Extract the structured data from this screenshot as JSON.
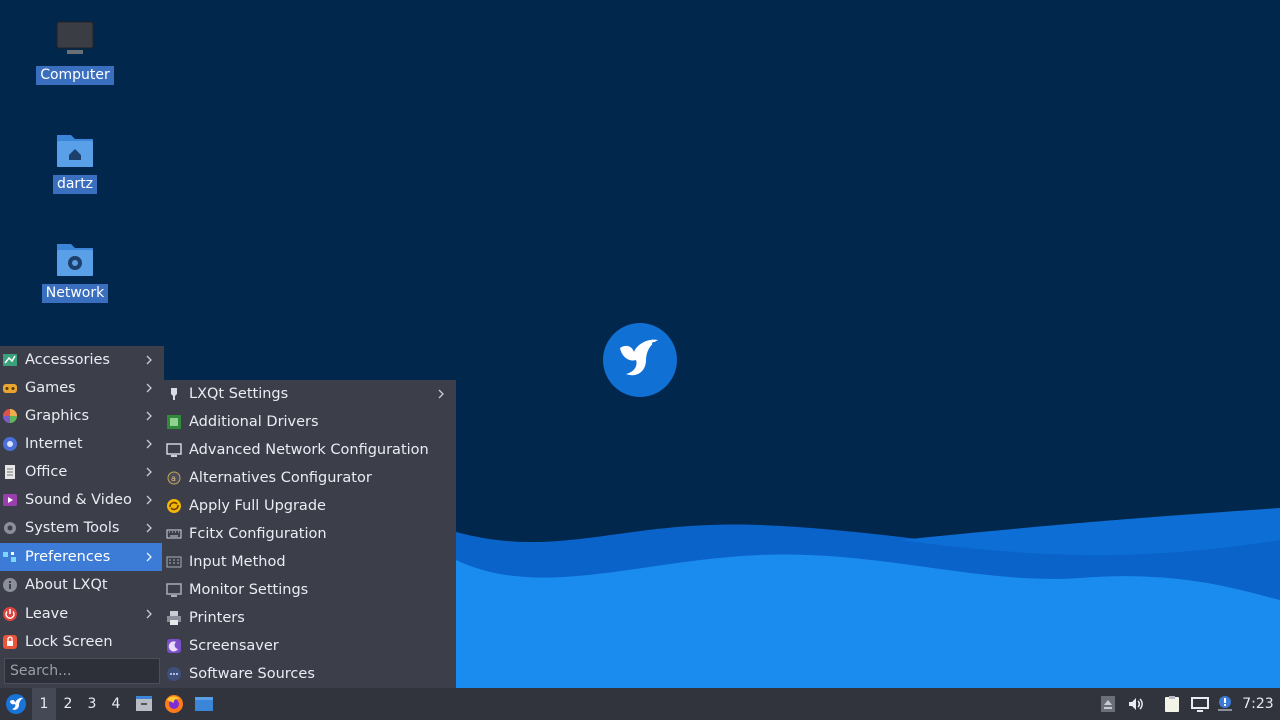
{
  "desktop": {
    "icons": [
      {
        "label": "Computer",
        "icon": "computer-icon"
      },
      {
        "label": "dartz",
        "icon": "home-folder-icon"
      },
      {
        "label": "Network",
        "icon": "network-folder-icon"
      }
    ],
    "logo": "lubuntu-bird-logo"
  },
  "main_menu": {
    "items": [
      {
        "label": "Accessories",
        "icon": "accessories-icon",
        "has_submenu": true
      },
      {
        "label": "Games",
        "icon": "games-icon",
        "has_submenu": true
      },
      {
        "label": "Graphics",
        "icon": "graphics-icon",
        "has_submenu": true
      },
      {
        "label": "Internet",
        "icon": "internet-icon",
        "has_submenu": true
      },
      {
        "label": "Office",
        "icon": "office-icon",
        "has_submenu": true
      },
      {
        "label": "Sound & Video",
        "icon": "sound-video-icon",
        "has_submenu": true
      },
      {
        "label": "System Tools",
        "icon": "system-tools-icon",
        "has_submenu": true
      },
      {
        "label": "Preferences",
        "icon": "preferences-icon",
        "has_submenu": true,
        "active": true
      },
      {
        "label": "About LXQt",
        "icon": "info-icon",
        "has_submenu": false
      },
      {
        "label": "Leave",
        "icon": "power-icon",
        "has_submenu": true
      },
      {
        "label": "Lock Screen",
        "icon": "lock-icon",
        "has_submenu": false
      }
    ],
    "search_placeholder": "Search..."
  },
  "sub_menu": {
    "items": [
      {
        "label": "LXQt Settings",
        "icon": "lxqt-settings-icon",
        "has_submenu": true
      },
      {
        "label": "Additional Drivers",
        "icon": "chip-icon",
        "has_submenu": false
      },
      {
        "label": "Advanced Network Configuration",
        "icon": "network-config-icon",
        "has_submenu": false
      },
      {
        "label": "Alternatives Configurator",
        "icon": "alternatives-icon",
        "has_submenu": false
      },
      {
        "label": "Apply Full Upgrade",
        "icon": "upgrade-icon",
        "has_submenu": false
      },
      {
        "label": "Fcitx Configuration",
        "icon": "keyboard-icon",
        "has_submenu": false
      },
      {
        "label": "Input Method",
        "icon": "input-method-icon",
        "has_submenu": false
      },
      {
        "label": "Monitor Settings",
        "icon": "monitor-icon",
        "has_submenu": false
      },
      {
        "label": "Printers",
        "icon": "printer-icon",
        "has_submenu": false
      },
      {
        "label": "Screensaver",
        "icon": "screensaver-icon",
        "has_submenu": false
      },
      {
        "label": "Software Sources",
        "icon": "software-sources-icon",
        "has_submenu": false
      }
    ]
  },
  "taskbar": {
    "start_icon": "lubuntu-start-icon",
    "workspaces": [
      "1",
      "2",
      "3",
      "4"
    ],
    "active_workspace": "1",
    "launchers": [
      "file-manager-icon",
      "firefox-icon",
      "show-desktop-icon"
    ],
    "tray": [
      "eject-icon",
      "volume-icon",
      "clipboard-icon",
      "network-icon",
      "update-notifier-icon"
    ],
    "clock": "7:23"
  },
  "colors": {
    "desktop_bg": "#02274d",
    "menu_bg": "#3c3f4a",
    "highlight": "#3d7cd6",
    "taskbar_bg": "#31343d",
    "wave_light": "#1a8cf0",
    "wave_dark": "#0a63c9"
  }
}
